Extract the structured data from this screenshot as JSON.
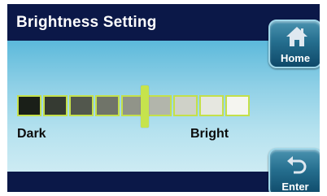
{
  "title": "Brightness Setting",
  "buttons": {
    "home": {
      "label": "Home",
      "icon": "home-icon"
    },
    "enter": {
      "label": "Enter",
      "icon": "undo-arrow-icon"
    }
  },
  "slider": {
    "min_label": "Dark",
    "max_label": "Bright",
    "segments": 9,
    "selected_level": 5,
    "segment_colors": [
      "#1a1f18",
      "#353a32",
      "#52574d",
      "#707469",
      "#919489",
      "#b2b5ab",
      "#cfd1c8",
      "#e6e7e0",
      "#f5f5f0"
    ],
    "accent_color": "#c4e04a"
  },
  "colors": {
    "frame_dark": "#0b1848",
    "button_accent": "#256e8e"
  }
}
